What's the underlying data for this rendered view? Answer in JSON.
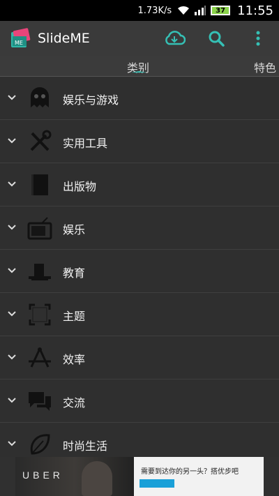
{
  "status_bar": {
    "speed": "1.73K/s",
    "battery": "37",
    "time": "11:55"
  },
  "action_bar": {
    "title": "SlideME",
    "accent_color": "#35c0b5"
  },
  "tabs": [
    {
      "label": "类别",
      "selected": true
    },
    {
      "label": "特色",
      "selected": false
    }
  ],
  "categories": [
    {
      "label": "娱乐与游戏",
      "icon": "game-ghost-icon"
    },
    {
      "label": "实用工具",
      "icon": "tools-icon"
    },
    {
      "label": "出版物",
      "icon": "book-icon"
    },
    {
      "label": "娱乐",
      "icon": "tv-icon"
    },
    {
      "label": "教育",
      "icon": "education-icon"
    },
    {
      "label": "主题",
      "icon": "theme-frame-icon"
    },
    {
      "label": "效率",
      "icon": "productivity-compass-icon"
    },
    {
      "label": "交流",
      "icon": "chat-bubble-icon"
    },
    {
      "label": "时尚生活",
      "icon": "leaf-icon"
    }
  ],
  "ad": {
    "brand": "UBER",
    "text": "需要到达你的另一头？搭优步吧"
  }
}
